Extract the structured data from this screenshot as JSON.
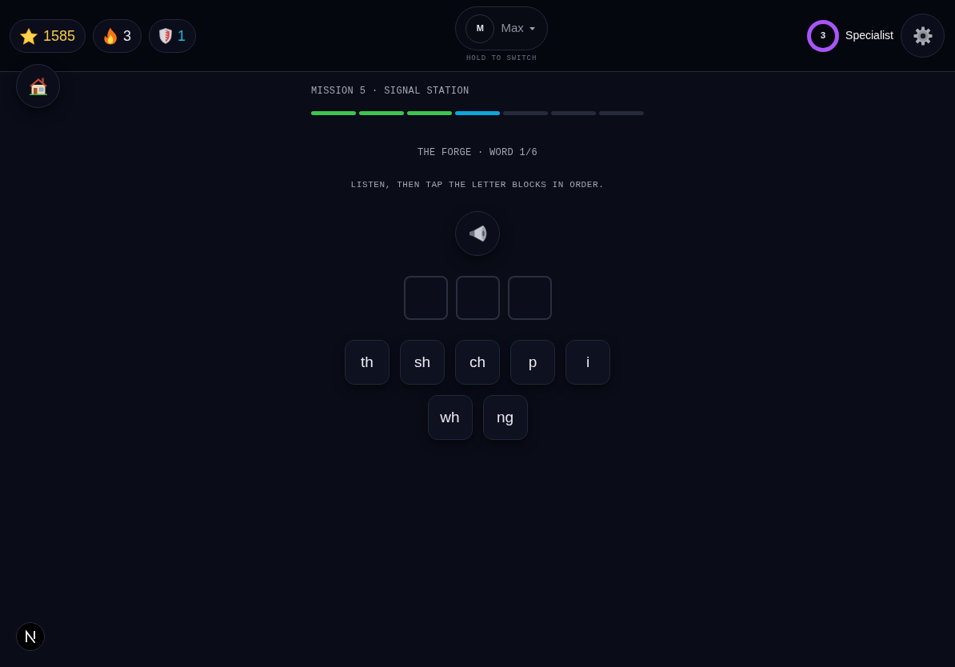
{
  "stats": [
    {
      "kind": "stars",
      "value": "1585",
      "color": "#f4c84a"
    },
    {
      "kind": "streak",
      "value": "3",
      "color": "#e5e7eb"
    },
    {
      "kind": "shields",
      "value": "1",
      "color": "#22b5e3"
    }
  ],
  "profile": {
    "initial": "M",
    "name": "Max",
    "hint": "HOLD TO SWITCH"
  },
  "rank": {
    "badge": "3",
    "title": "Specialist"
  },
  "mission": {
    "title": "MISSION 5 · SIGNAL STATION",
    "steps": [
      {
        "done": true,
        "selected": false
      },
      {
        "done": true,
        "selected": false
      },
      {
        "done": true,
        "selected": false
      },
      {
        "done": false,
        "selected": true
      },
      {
        "done": false,
        "selected": false
      },
      {
        "done": false,
        "selected": false
      },
      {
        "done": false,
        "selected": false
      }
    ]
  },
  "word_header": "THE FORGE · WORD 1/6",
  "instruction": "LISTEN, THEN TAP THE LETTER BLOCKS IN ORDER.",
  "answer_slots": [
    {
      "filled": false
    },
    {
      "filled": false
    },
    {
      "filled": false
    }
  ],
  "letter_blocks": [
    "th",
    "sh",
    "ch",
    "p",
    "i",
    "wh",
    "ng"
  ]
}
